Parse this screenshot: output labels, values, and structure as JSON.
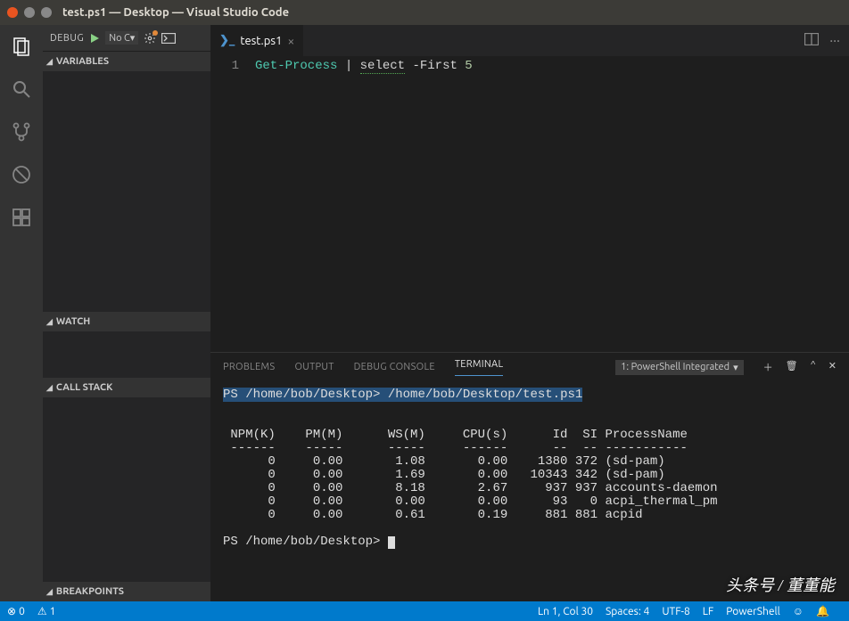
{
  "window": {
    "title": "test.ps1 — Desktop — Visual Studio Code"
  },
  "debug_toolbar": {
    "label": "DEBUG",
    "config": "No C",
    "config_arrow": "▾"
  },
  "sidebar_sections": {
    "variables": "VARIABLES",
    "watch": "WATCH",
    "call_stack": "CALL STACK",
    "breakpoints": "BREAKPOINTS"
  },
  "tabs": {
    "file_icon": "❯_",
    "file_name": "test.ps1",
    "close": "×",
    "more": "···"
  },
  "code": {
    "line_no": "1",
    "seg1": "Get-Process",
    "seg2": " | ",
    "seg3": "select",
    "seg4": " -First ",
    "seg5": "5"
  },
  "panel_tabs": {
    "problems": "PROBLEMS",
    "output": "OUTPUT",
    "debug_console": "DEBUG CONSOLE",
    "terminal": "TERMINAL",
    "selector": "1: PowerShell Integrated",
    "selector_arrow": "▾",
    "icon_new": "＋",
    "icon_trash": "🗑",
    "icon_up": "^",
    "icon_close": "✕"
  },
  "terminal": {
    "line1_a": "PS /home/bob/Desktop>",
    "line1_b": " /home/bob/Desktop/test.ps1",
    "header": " NPM(K)    PM(M)      WS(M)     CPU(s)      Id  SI ProcessName",
    "divider": " ------    -----      -----     ------      --  -- -----------",
    "rows": [
      "      0     0.00       1.08       0.00    1380 372 (sd-pam)",
      "      0     0.00       1.69       0.00   10343 342 (sd-pam)",
      "      0     0.00       8.18       2.67     937 937 accounts-daemon",
      "      0     0.00       0.00       0.00      93   0 acpi_thermal_pm",
      "      0     0.00       0.61       0.19     881 881 acpid"
    ],
    "prompt2": "PS /home/bob/Desktop> "
  },
  "statusbar": {
    "errors_icon": "⊗",
    "errors": "0",
    "warnings_icon": "⚠",
    "warnings": "1",
    "ln_col": "Ln 1, Col 30",
    "spaces": "Spaces: 4",
    "encoding": "UTF-8",
    "eol": "LF",
    "lang": "PowerShell",
    "feedback": "☺",
    "bell": "🔔"
  },
  "watermark": "头条号 / 董董能"
}
